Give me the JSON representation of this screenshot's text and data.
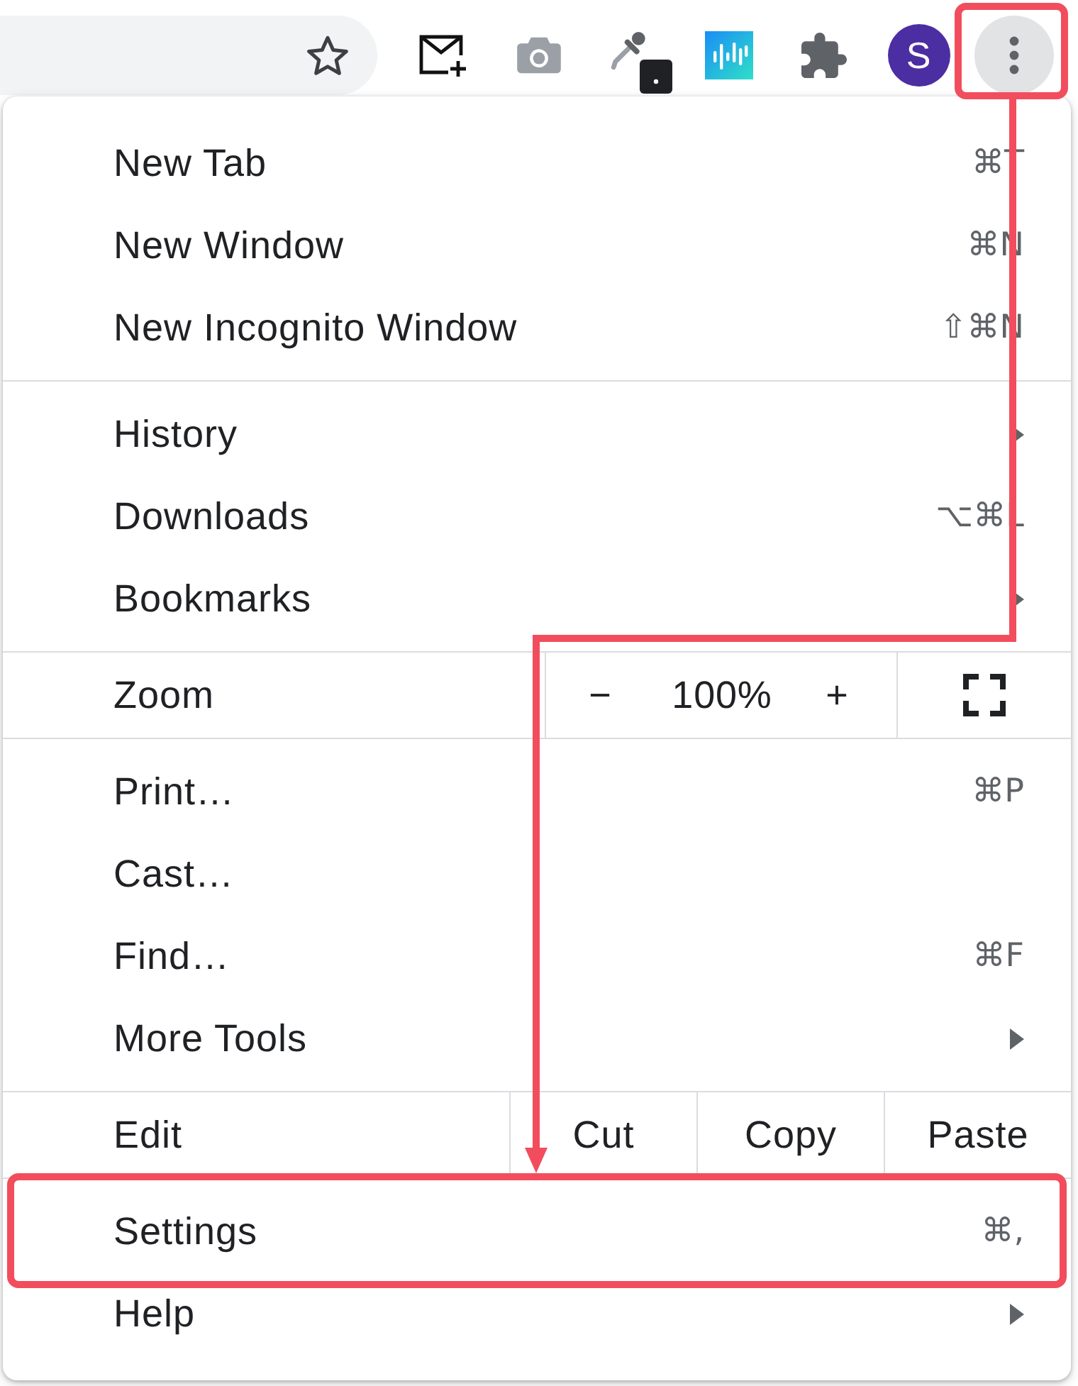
{
  "toolbar": {
    "avatar": {
      "initial": "S"
    },
    "menu_button": {
      "highlighted": true
    }
  },
  "menu": {
    "sections": [
      {
        "items": [
          {
            "kind": "command",
            "label": "New Tab",
            "shortcut": "⌘T",
            "submenu": false,
            "highlighted": false
          },
          {
            "kind": "command",
            "label": "New Window",
            "shortcut": "⌘N",
            "submenu": false,
            "highlighted": false
          },
          {
            "kind": "command",
            "label": "New Incognito Window",
            "shortcut": "⇧⌘N",
            "submenu": false,
            "highlighted": false
          }
        ]
      },
      {
        "items": [
          {
            "kind": "command",
            "label": "History",
            "submenu": true,
            "highlighted": false
          },
          {
            "kind": "command",
            "label": "Downloads",
            "shortcut": "⌥⌘L",
            "submenu": false,
            "highlighted": false
          },
          {
            "kind": "command",
            "label": "Bookmarks",
            "submenu": true,
            "highlighted": false
          }
        ]
      },
      {
        "items": [
          {
            "kind": "zoom",
            "label": "Zoom",
            "decrease": "−",
            "value": "100%",
            "increase": "+",
            "highlighted": false
          }
        ]
      },
      {
        "items": [
          {
            "kind": "command",
            "label": "Print…",
            "shortcut": "⌘P",
            "submenu": false,
            "highlighted": false
          },
          {
            "kind": "command",
            "label": "Cast…",
            "submenu": false,
            "highlighted": false
          },
          {
            "kind": "command",
            "label": "Find…",
            "shortcut": "⌘F",
            "submenu": false,
            "highlighted": false
          },
          {
            "kind": "command",
            "label": "More Tools",
            "submenu": true,
            "highlighted": false
          }
        ]
      },
      {
        "items": [
          {
            "kind": "edit",
            "label": "Edit",
            "actions": [
              "Cut",
              "Copy",
              "Paste"
            ],
            "highlighted": false
          }
        ]
      },
      {
        "items": [
          {
            "kind": "command",
            "label": "Settings",
            "shortcut": "⌘,",
            "submenu": false,
            "highlighted": true
          },
          {
            "kind": "command",
            "label": "Help",
            "submenu": true,
            "highlighted": false
          }
        ]
      }
    ]
  }
}
